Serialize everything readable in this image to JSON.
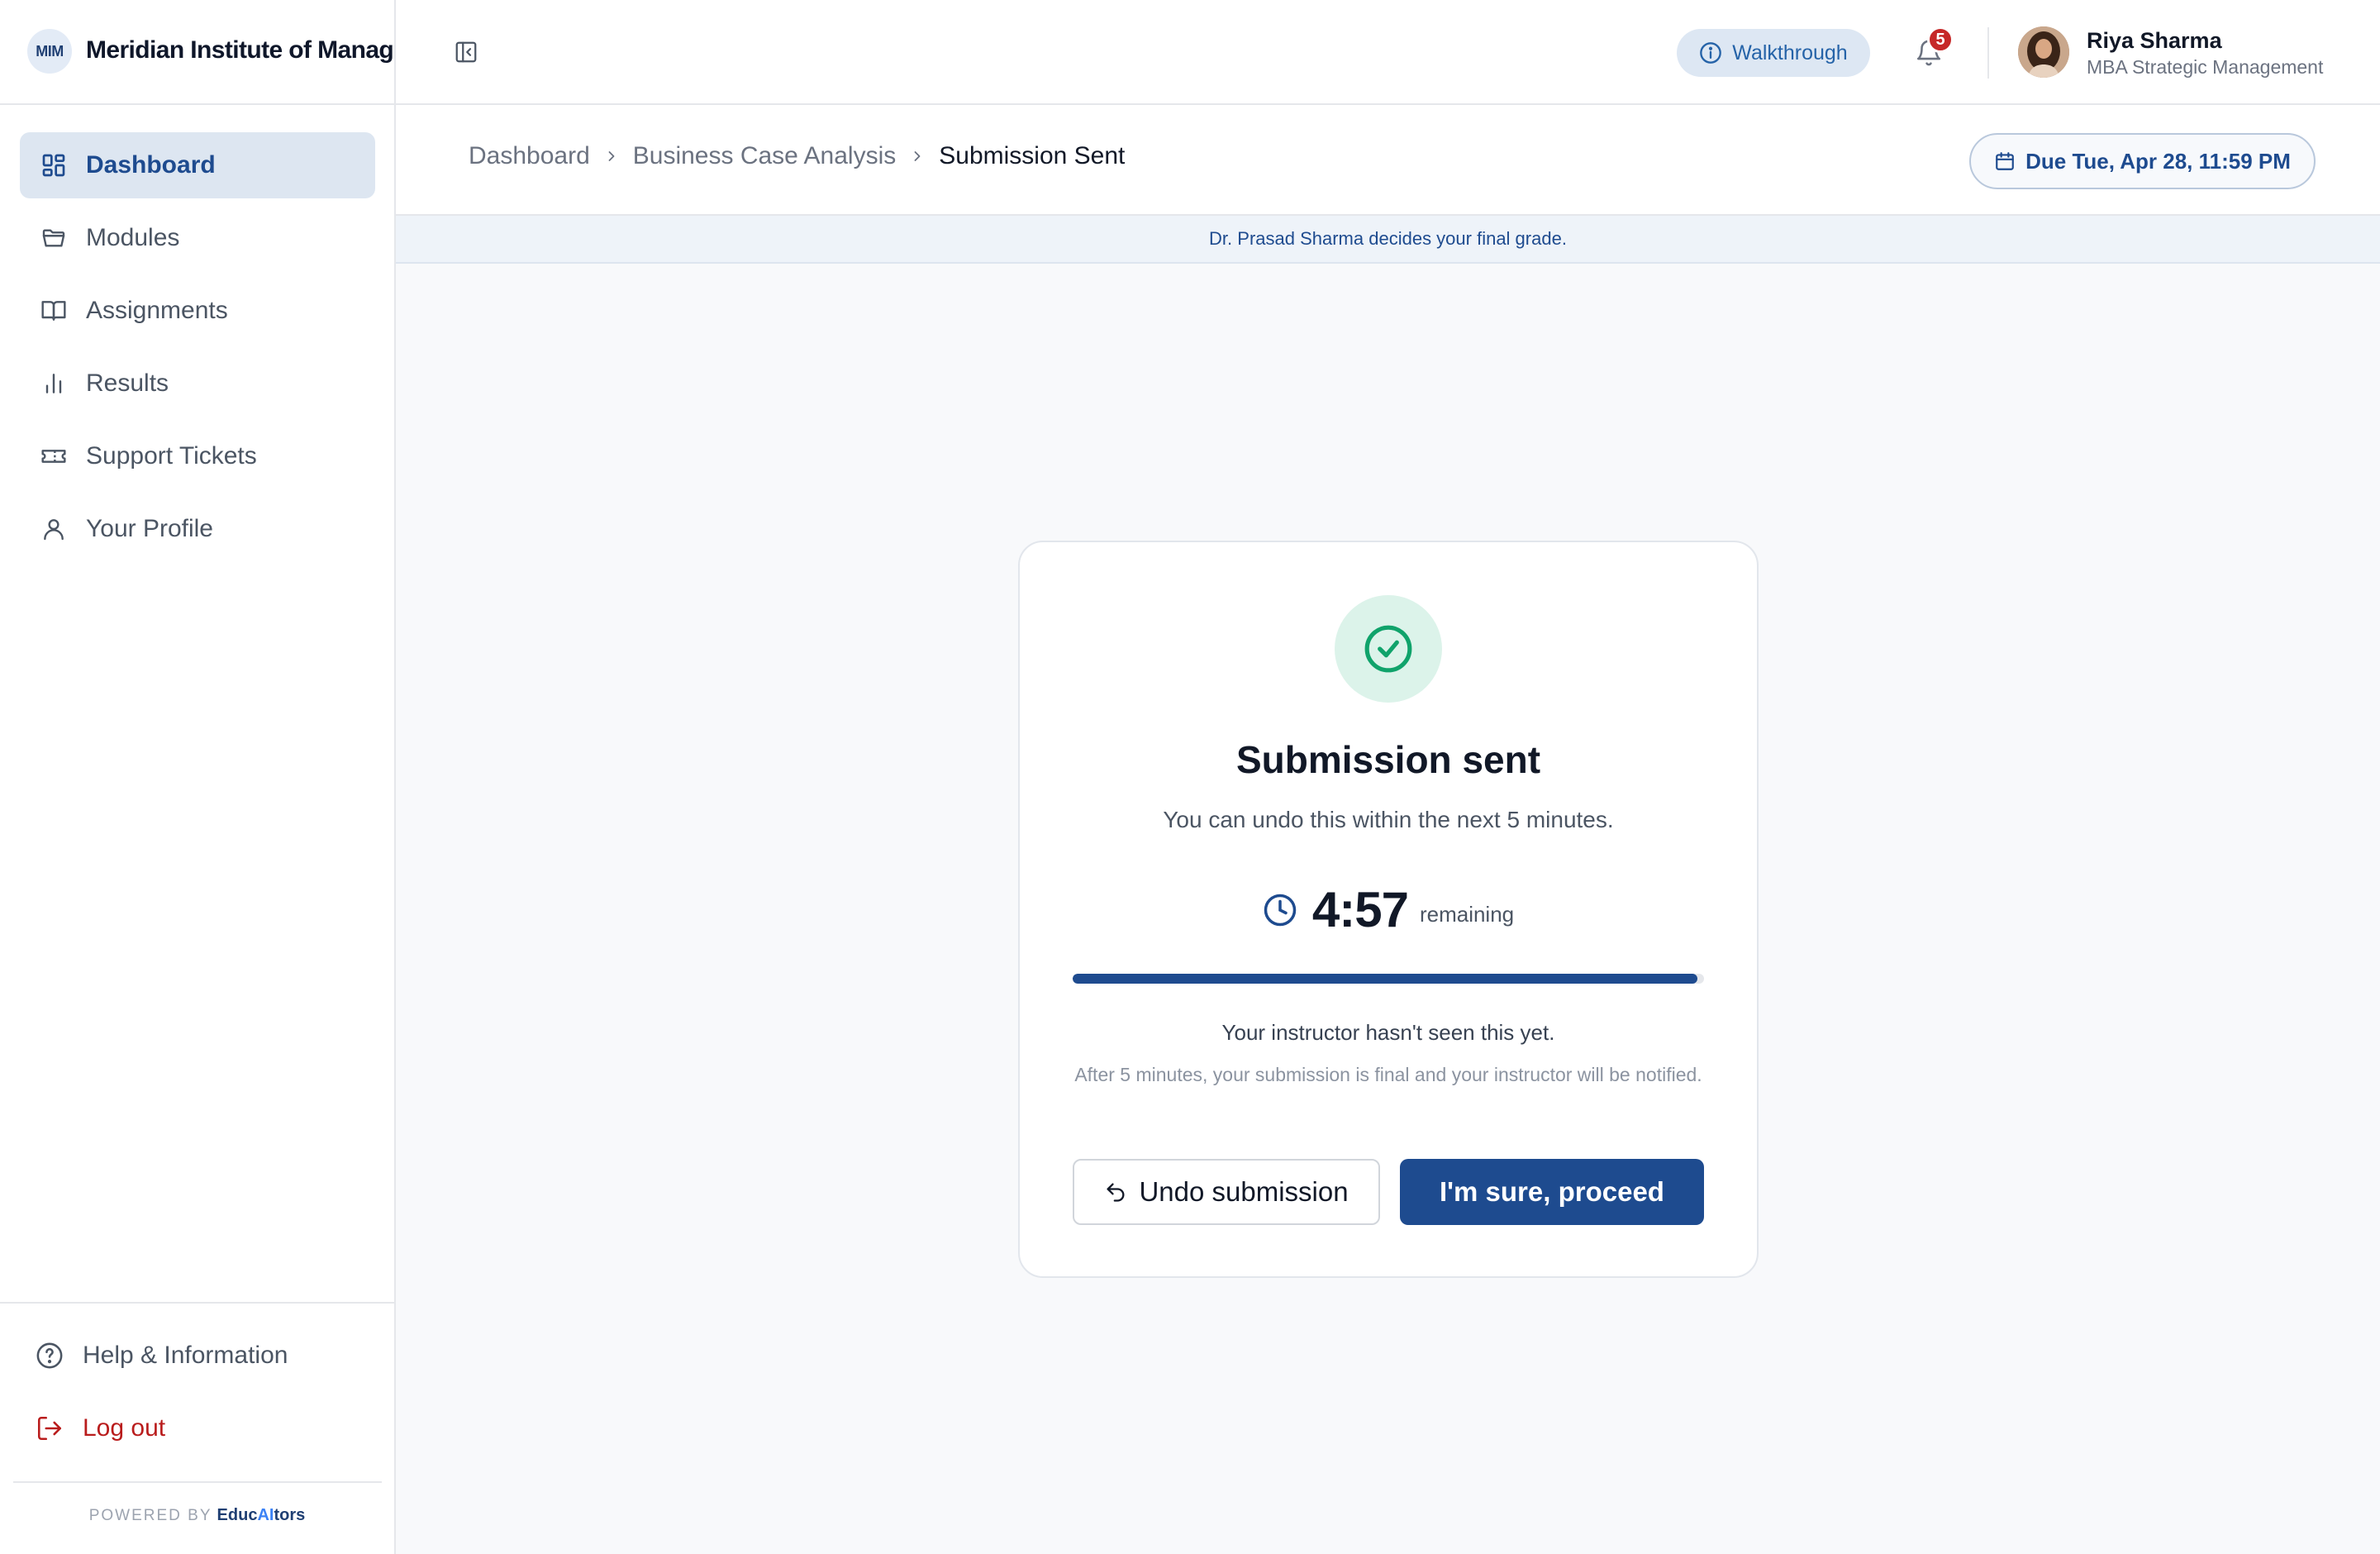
{
  "brand": {
    "logo_text": "MIM",
    "name": "Meridian Institute of Management"
  },
  "sidebar": {
    "items": [
      {
        "label": "Dashboard",
        "icon": "dashboard-grid-icon",
        "active": true
      },
      {
        "label": "Modules",
        "icon": "folder-icon"
      },
      {
        "label": "Assignments",
        "icon": "book-open-icon"
      },
      {
        "label": "Results",
        "icon": "bar-chart-icon"
      },
      {
        "label": "Support Tickets",
        "icon": "ticket-icon"
      },
      {
        "label": "Your Profile",
        "icon": "user-icon"
      }
    ],
    "help_label": "Help & Information",
    "logout_label": "Log out",
    "powered_by": "POWERED BY",
    "powered_brand_a": "Educ",
    "powered_brand_b": "AI",
    "powered_brand_c": "tors"
  },
  "topbar": {
    "walkthrough_label": "Walkthrough",
    "notification_count": "5",
    "user_name": "Riya Sharma",
    "user_program": "MBA Strategic Management"
  },
  "breadcrumb": {
    "items": [
      "Dashboard",
      "Business Case Analysis",
      "Submission Sent"
    ]
  },
  "due": {
    "label": "Due Tue, Apr 28, 11:59 PM"
  },
  "notice": {
    "text": "Dr. Prasad Sharma decides your final grade."
  },
  "card": {
    "title": "Submission sent",
    "subtitle": "You can undo this within the next 5 minutes.",
    "timer_value": "4:57",
    "timer_label": "remaining",
    "progress_fraction": 0.99,
    "note_primary": "Your instructor hasn't seen this yet.",
    "note_secondary": "After 5 minutes, your submission is final and your instructor will be notified.",
    "undo_label": "Undo submission",
    "proceed_label": "I'm sure, proceed"
  },
  "colors": {
    "accent": "#1e4b8f",
    "success": "#10a36b",
    "danger": "#b91c1c",
    "badge": "#c62828"
  }
}
